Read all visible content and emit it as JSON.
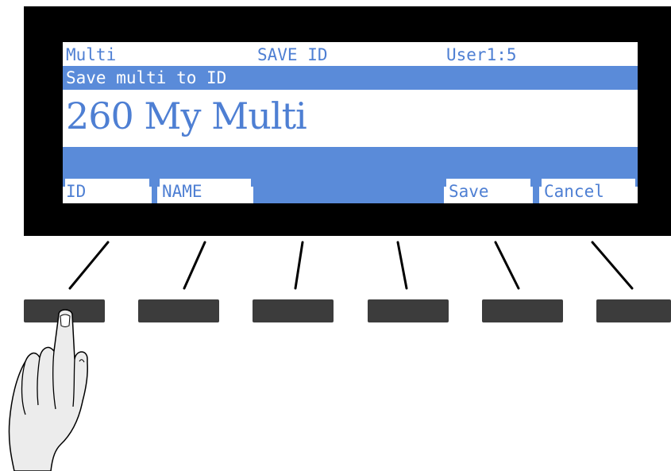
{
  "display": {
    "header": {
      "mode": "Multi",
      "screen": "SAVE ID",
      "location": "User1:5"
    },
    "prompt": "Save multi to ID",
    "entry": "260 My Multi",
    "soft_buttons": [
      "ID",
      "NAME",
      "",
      "",
      "Save",
      "Cancel"
    ]
  },
  "colors": {
    "lcd_accent": "#5a8bd9",
    "bezel": "#000000",
    "button": "#3c3c3c"
  },
  "illustration": {
    "pressed_button_index": 0,
    "icon": "finger-pointing-hand-icon"
  }
}
